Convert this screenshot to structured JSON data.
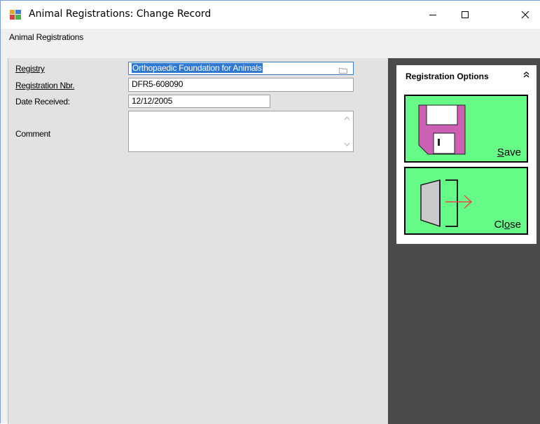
{
  "window": {
    "title": "Animal Registrations: Change Record"
  },
  "menu": {
    "item": "Animal Registrations"
  },
  "form": {
    "registry_label": "Registry",
    "registry_value": "Orthopaedic Foundation for Animals",
    "registration_nbr_label": "Registration Nbr.",
    "registration_nbr_value": "DFR5-608090",
    "date_received_label": "Date Received:",
    "date_received_value": "12/12/2005",
    "comment_label": "Comment",
    "comment_value": ""
  },
  "options": {
    "title": "Registration Options",
    "save_label_accel": "S",
    "save_label_rest": "ave",
    "close_label_pre": "Cl",
    "close_label_accel": "o",
    "close_label_post": "se"
  },
  "colors": {
    "tile_green": "#66fa87",
    "panel_dark": "#4b4b4b",
    "form_bg": "#e2e2e2",
    "selection_blue": "#3079d1",
    "floppy_magenta": "#cc60b4",
    "arrow_red": "#e84a4a"
  },
  "icons": {
    "app": "app-form-icon",
    "minimize": "minimize-icon",
    "maximize": "maximize-icon",
    "close": "close-x-icon",
    "registry_browse": "folder-icon",
    "collapse": "double-chevron-up-icon",
    "save": "floppy-disk-icon",
    "exit": "door-exit-icon"
  }
}
